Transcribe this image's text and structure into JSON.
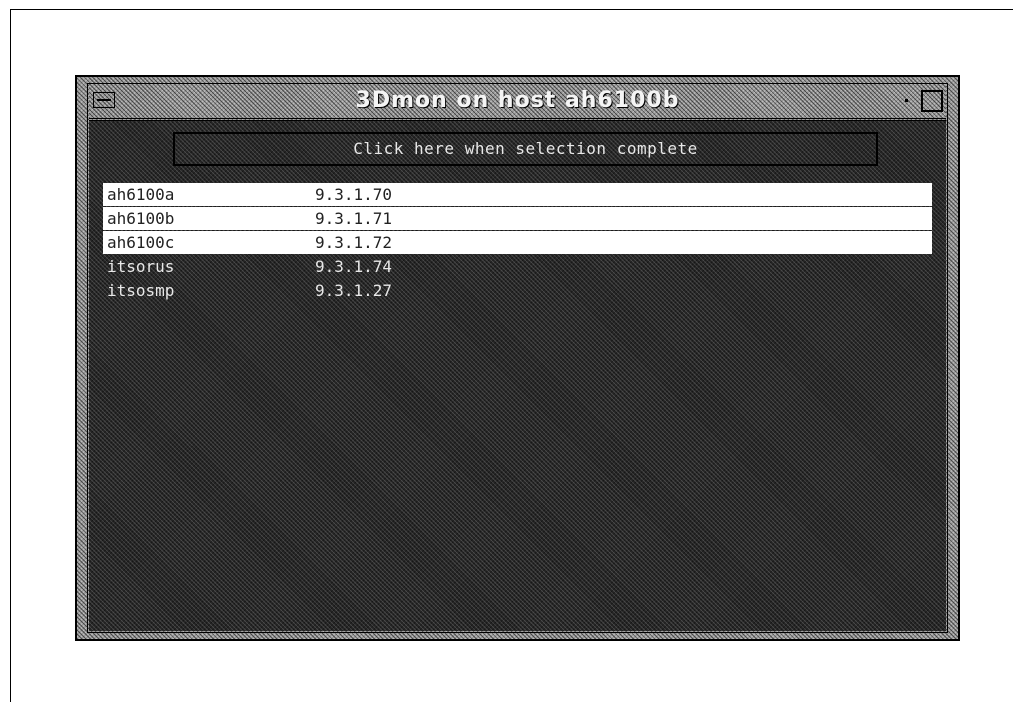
{
  "window": {
    "title": "3Dmon on host ah6100b"
  },
  "action_button": {
    "label": "Click here when selection complete"
  },
  "hosts": [
    {
      "name": "ah6100a",
      "ip": "9.3.1.70",
      "selected": true
    },
    {
      "name": "ah6100b",
      "ip": "9.3.1.71",
      "selected": true
    },
    {
      "name": "ah6100c",
      "ip": "9.3.1.72",
      "selected": true
    },
    {
      "name": "itsorus",
      "ip": "9.3.1.74",
      "selected": false
    },
    {
      "name": "itsosmp",
      "ip": "9.3.1.27",
      "selected": false
    }
  ],
  "icons": {
    "window_menu": "window-menu-icon",
    "minimize": "minimize-icon",
    "maximize": "maximize-icon"
  }
}
